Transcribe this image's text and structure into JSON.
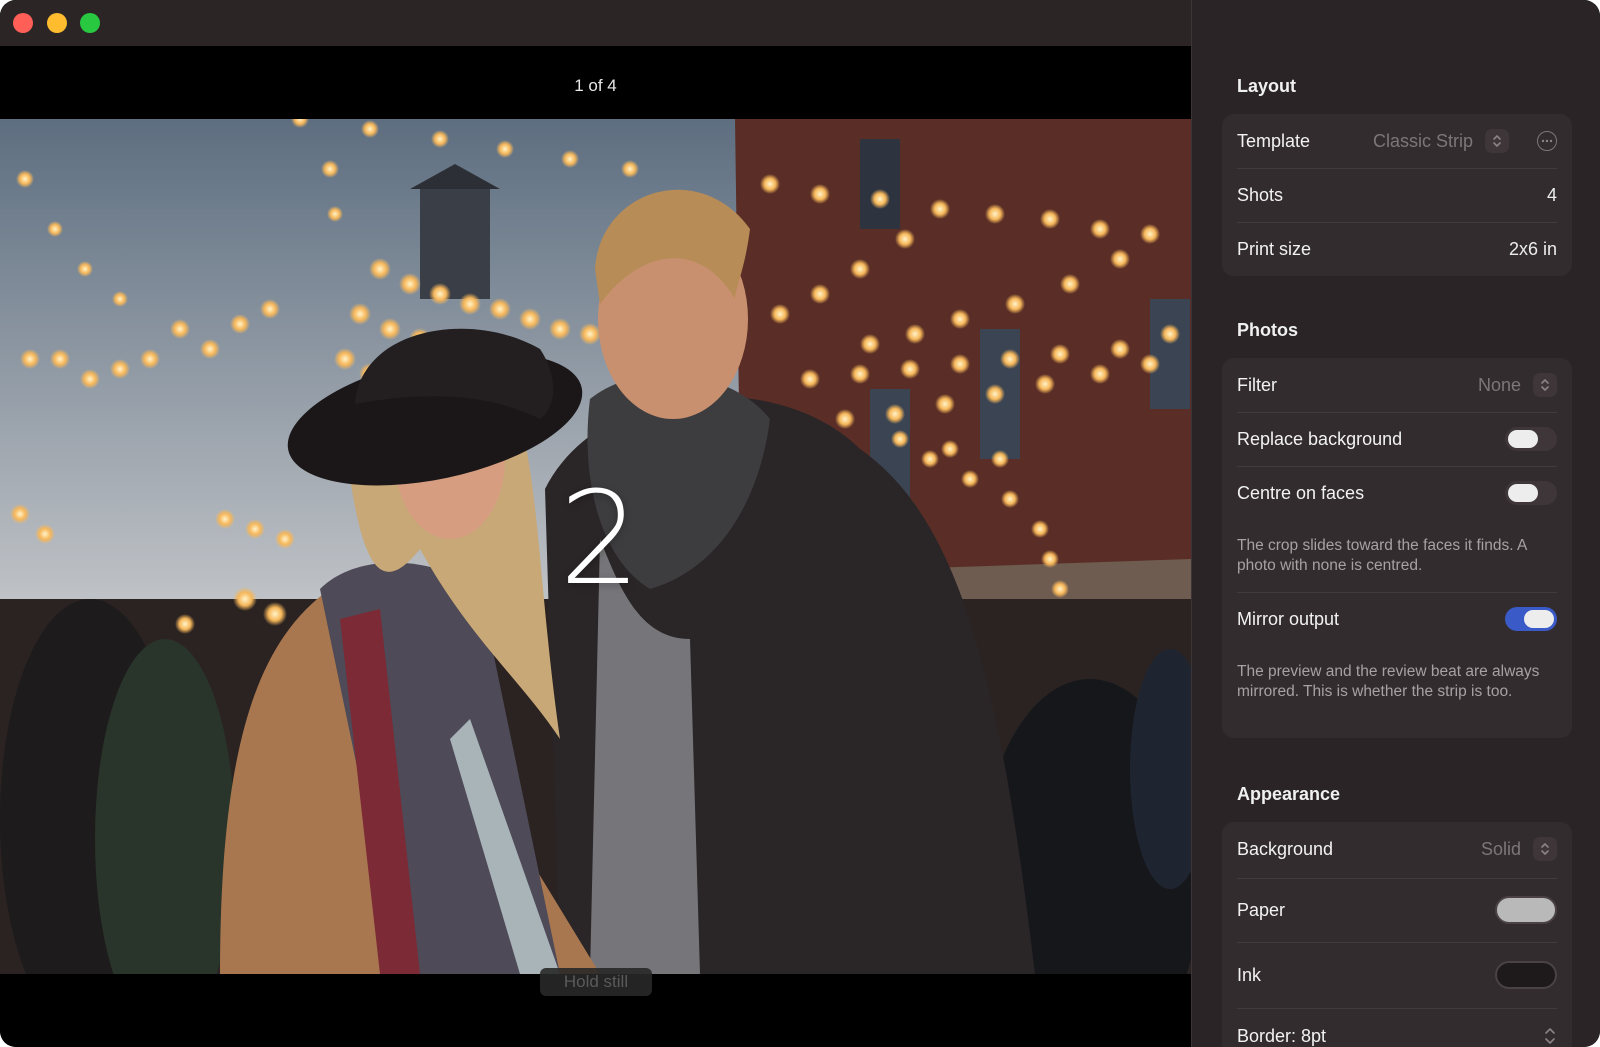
{
  "camera": {
    "shot_counter": "1 of 4",
    "countdown": "2",
    "status_pill": "Hold still"
  },
  "sidebar": {
    "layout": {
      "title": "Layout",
      "template_label": "Template",
      "template_value": "Classic Strip",
      "shots_label": "Shots",
      "shots_value": "4",
      "print_size_label": "Print size",
      "print_size_value": "2x6 in"
    },
    "photos": {
      "title": "Photos",
      "filter_label": "Filter",
      "filter_value": "None",
      "replace_background_label": "Replace background",
      "replace_background_on": false,
      "centre_on_faces_label": "Centre on faces",
      "centre_on_faces_on": false,
      "centre_note": "The crop slides toward the faces it finds. A photo with none is centred.",
      "mirror_output_label": "Mirror output",
      "mirror_output_on": true,
      "mirror_note": "The preview and the review beat are always mirrored. This is whether the strip is too."
    },
    "appearance": {
      "title": "Appearance",
      "background_label": "Background",
      "background_value": "Solid",
      "paper_label": "Paper",
      "paper_color": "#b9b9b9",
      "ink_label": "Ink",
      "ink_color": "#1e1a1b",
      "border_label": "Border: 8pt"
    }
  },
  "colors": {
    "accent": "#3a5bc7",
    "sidebar_bg": "#2a2426",
    "group_bg": "#332c2e",
    "traffic_close": "#ff5f57",
    "traffic_min": "#febc2e",
    "traffic_max": "#28c840"
  }
}
